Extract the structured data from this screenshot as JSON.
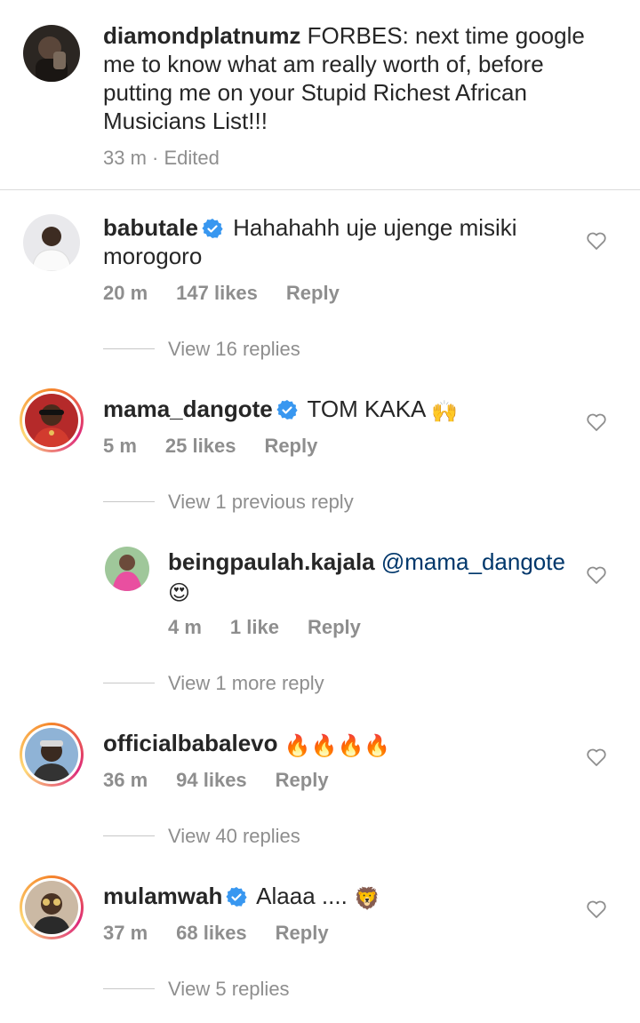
{
  "caption": {
    "username": "diamondplatnumz",
    "text_line1": "FORBES: next time google",
    "text_line2": "me to know what am really worth of, before",
    "text_line3": "putting me on your Stupid Richest African",
    "text_line4": "Musicians List!!!",
    "time": "33 m",
    "separator": "·",
    "edited": "Edited"
  },
  "comments": [
    {
      "username": "babutale",
      "verified": true,
      "text_line1": "Hahahahh uje ujenge misiki",
      "text_line2": "morogoro",
      "time": "20 m",
      "likes": "147 likes",
      "reply": "Reply",
      "view_replies": "View 16 replies"
    },
    {
      "username": "mama_dangote",
      "verified": true,
      "text": "TOM KAKA",
      "emoji": "🙌",
      "time": "5 m",
      "likes": "25 likes",
      "reply": "Reply",
      "view_previous": "View 1 previous reply",
      "nested_reply": {
        "username": "beingpaulah.kajala",
        "mention": "@mama_dangote",
        "emoji": "😍",
        "time": "4 m",
        "likes": "1 like",
        "reply": "Reply"
      },
      "view_more": "View 1 more reply"
    },
    {
      "username": "officialbabalevo",
      "verified": false,
      "emoji": "🔥🔥🔥🔥",
      "time": "36 m",
      "likes": "94 likes",
      "reply": "Reply",
      "view_replies": "View 40 replies"
    },
    {
      "username": "mulamwah",
      "verified": true,
      "text": "Alaaa ....",
      "emoji": "🦁",
      "time": "37 m",
      "likes": "68 likes",
      "reply": "Reply",
      "view_replies": "View 5 replies"
    }
  ],
  "icons": {
    "verified": "verified-badge-icon",
    "heart": "heart-outline-icon"
  },
  "colors": {
    "verified_blue": "#3897f0",
    "secondary_text": "#8e8e8e",
    "mention_link": "#00376b"
  }
}
